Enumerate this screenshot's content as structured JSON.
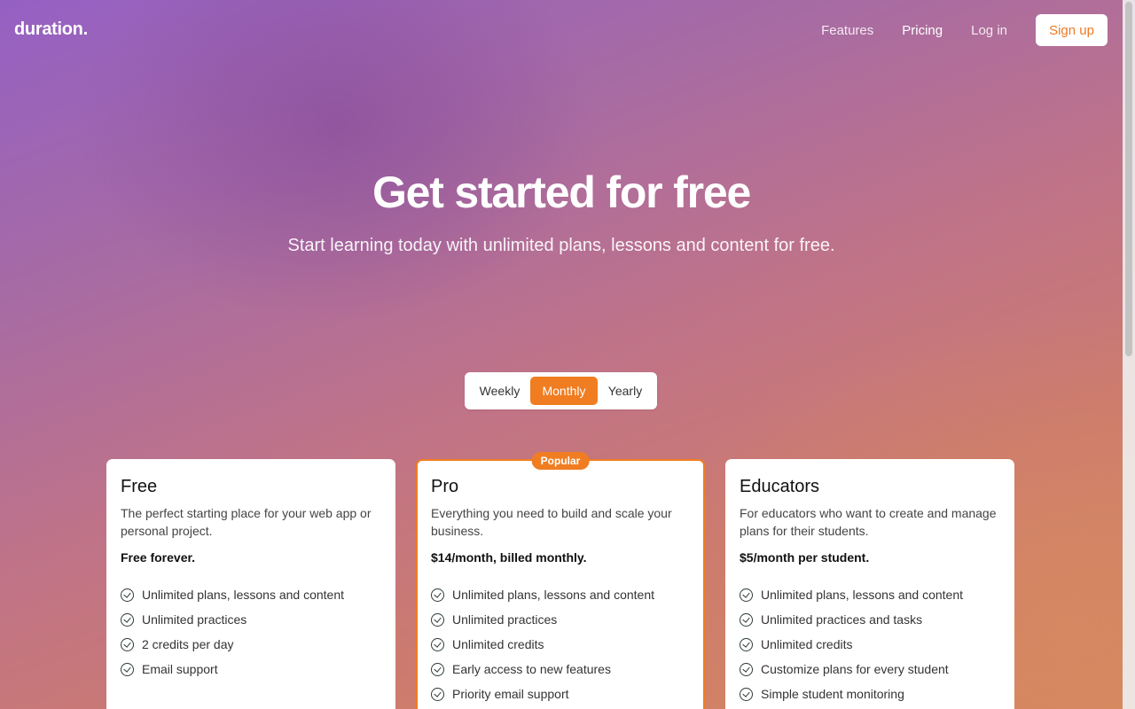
{
  "brand": "duration.",
  "nav": {
    "features": "Features",
    "pricing": "Pricing",
    "login": "Log in",
    "signup": "Sign up"
  },
  "hero": {
    "title": "Get started for free",
    "subtitle": "Start learning today with unlimited plans, lessons and content for free."
  },
  "billing": {
    "options": [
      "Weekly",
      "Monthly",
      "Yearly"
    ],
    "selected": "Monthly"
  },
  "plans": [
    {
      "name": "Free",
      "description": "The perfect starting place for your web app or personal project.",
      "price": "Free forever.",
      "features": [
        "Unlimited plans, lessons and content",
        "Unlimited practices",
        "2 credits per day",
        "Email support"
      ]
    },
    {
      "name": "Pro",
      "badge": "Popular",
      "description": "Everything you need to build and scale your business.",
      "price": "$14/month, billed monthly.",
      "features": [
        "Unlimited plans, lessons and content",
        "Unlimited practices",
        "Unlimited credits",
        "Early access to new features",
        "Priority email support"
      ]
    },
    {
      "name": "Educators",
      "description": "For educators who want to create and manage plans for their students.",
      "price": "$5/month per student.",
      "features": [
        "Unlimited plans, lessons and content",
        "Unlimited practices and tasks",
        "Unlimited credits",
        "Customize plans for every student",
        "Simple student monitoring"
      ]
    }
  ],
  "colors": {
    "accent": "#f07d21"
  }
}
